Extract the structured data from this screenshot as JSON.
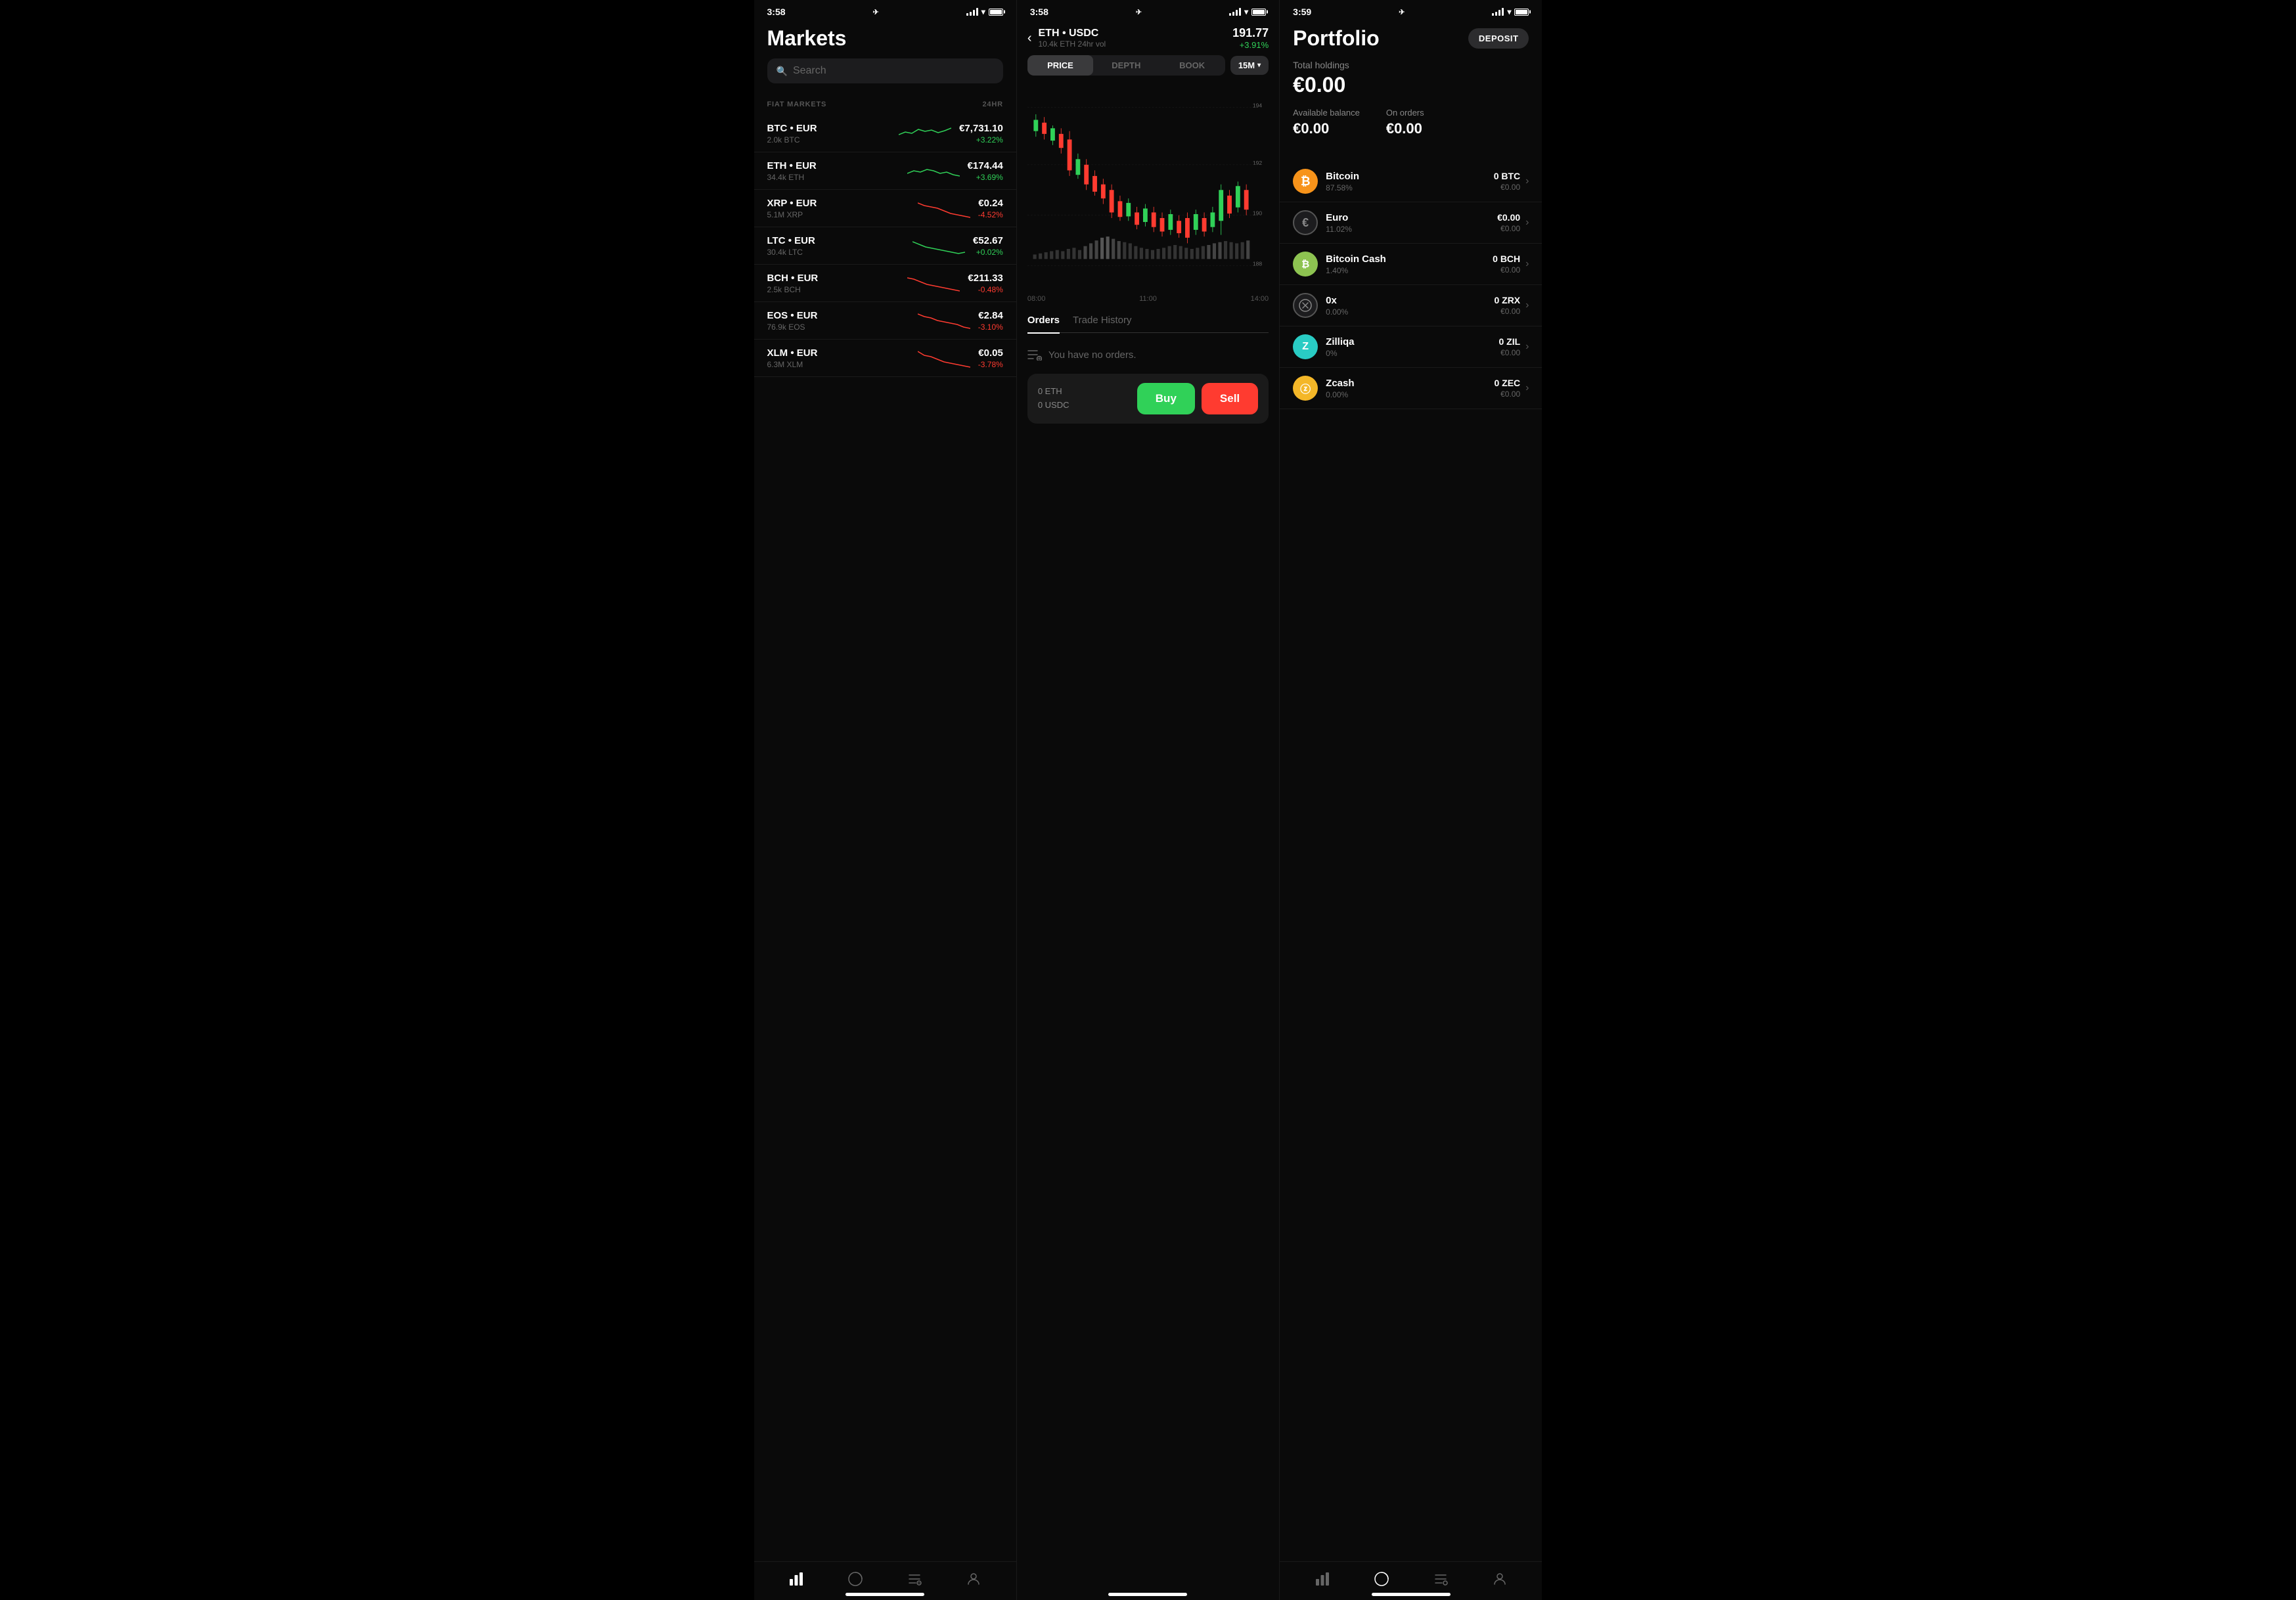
{
  "phone1": {
    "statusBar": {
      "time": "3:58",
      "location": true
    },
    "title": "Markets",
    "search": {
      "placeholder": "Search"
    },
    "sectionLabel": "FIAT MARKETS",
    "sectionHeader24hr": "24HR",
    "markets": [
      {
        "pair": "BTC • EUR",
        "volume": "2.0k BTC",
        "price": "€7,731.10",
        "change": "+3.22%",
        "positive": true
      },
      {
        "pair": "ETH • EUR",
        "volume": "34.4k ETH",
        "price": "€174.44",
        "change": "+3.69%",
        "positive": true
      },
      {
        "pair": "XRP • EUR",
        "volume": "5.1M XRP",
        "price": "€0.24",
        "change": "-4.52%",
        "positive": false
      },
      {
        "pair": "LTC • EUR",
        "volume": "30.4k LTC",
        "price": "€52.67",
        "change": "+0.02%",
        "positive": true
      },
      {
        "pair": "BCH • EUR",
        "volume": "2.5k BCH",
        "price": "€211.33",
        "change": "-0.48%",
        "positive": false
      },
      {
        "pair": "EOS • EUR",
        "volume": "76.9k EOS",
        "price": "€2.84",
        "change": "-3.10%",
        "positive": false
      },
      {
        "pair": "XLM • EUR",
        "volume": "6.3M XLM",
        "price": "€0.05",
        "change": "-3.78%",
        "positive": false
      }
    ],
    "nav": [
      "markets",
      "portfolio",
      "orders",
      "account"
    ]
  },
  "phone2": {
    "statusBar": {
      "time": "3:58"
    },
    "pairName": "ETH • USDC",
    "pairVolume": "10.4k ETH 24hr vol",
    "price": "191.77",
    "change": "+3.91%",
    "tabs": [
      "PRICE",
      "DEPTH",
      "BOOK"
    ],
    "activeTab": "PRICE",
    "timeframe": "15M",
    "chartLabels": [
      "08:00",
      "11:00",
      "14:00"
    ],
    "chartPrices": [
      "194",
      "192",
      "190",
      "188"
    ],
    "ordersTab": "Orders",
    "tradeHistoryTab": "Trade History",
    "noOrdersText": "You have no orders.",
    "tradeBar": {
      "ethAmount": "0 ETH",
      "usdcAmount": "0 USDC",
      "buyLabel": "Buy",
      "sellLabel": "Sell"
    }
  },
  "phone3": {
    "statusBar": {
      "time": "3:59"
    },
    "title": "Portfolio",
    "depositLabel": "DEPOSIT",
    "holdingsLabel": "Total holdings",
    "holdingsTotal": "€0.00",
    "availableLabel": "Available balance",
    "availableValue": "€0.00",
    "onOrdersLabel": "On orders",
    "onOrdersValue": "€0.00",
    "assets": [
      {
        "name": "Bitcoin",
        "pct": "87.58%",
        "amount": "0 BTC",
        "eur": "€0.00",
        "iconType": "btc",
        "iconText": "₿"
      },
      {
        "name": "Euro",
        "pct": "11.02%",
        "amount": "€0.00",
        "eur": "€0.00",
        "iconType": "euro",
        "iconText": "€"
      },
      {
        "name": "Bitcoin Cash",
        "pct": "1.40%",
        "amount": "0 BCH",
        "eur": "€0.00",
        "iconType": "bch",
        "iconText": "₿"
      },
      {
        "name": "0x",
        "pct": "0.00%",
        "amount": "0 ZRX",
        "eur": "€0.00",
        "iconType": "zrx",
        "iconText": "⊗"
      },
      {
        "name": "Zilliqa",
        "pct": "0%",
        "amount": "0 ZIL",
        "eur": "€0.00",
        "iconType": "zil",
        "iconText": "Z"
      },
      {
        "name": "Zcash",
        "pct": "0.00%",
        "amount": "0 ZEC",
        "eur": "€0.00",
        "iconType": "zec",
        "iconText": "ⓩ"
      }
    ]
  }
}
